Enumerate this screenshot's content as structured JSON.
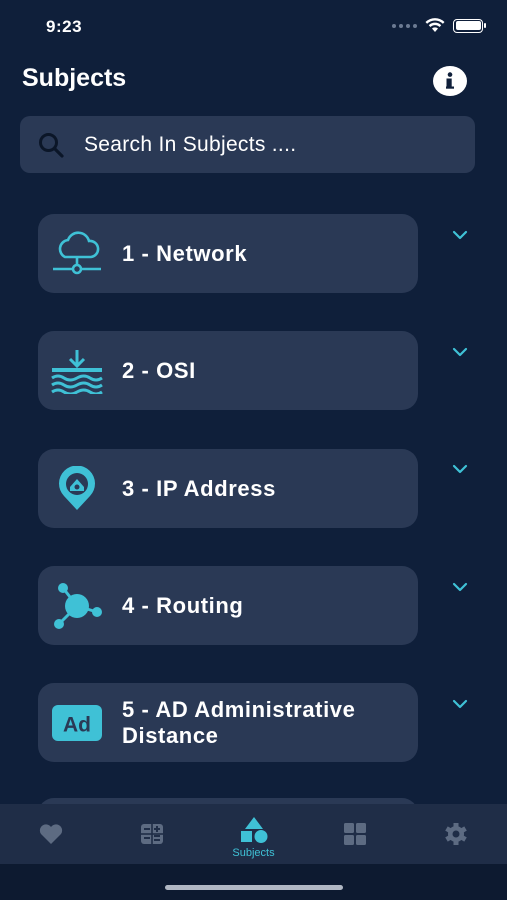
{
  "status_bar": {
    "time": "9:23"
  },
  "header": {
    "title": "Subjects"
  },
  "search": {
    "placeholder": "Search In Subjects ...."
  },
  "subjects": [
    {
      "label": "1 - Network",
      "icon": "cloud-network-icon"
    },
    {
      "label": "2 - OSI",
      "icon": "download-layers-icon"
    },
    {
      "label": "3 - IP Address",
      "icon": "location-pin-icon"
    },
    {
      "label": "4 - Routing",
      "icon": "hub-nodes-icon"
    },
    {
      "label": "5 - AD Administrative Distance",
      "icon": "ad-badge-icon",
      "badge": "Ad"
    }
  ],
  "tab_bar": {
    "tabs": [
      {
        "icon": "heart-icon",
        "label": ""
      },
      {
        "icon": "calculator-icon",
        "label": ""
      },
      {
        "icon": "shapes-icon",
        "label": "Subjects",
        "active": true
      },
      {
        "icon": "grid-icon",
        "label": ""
      },
      {
        "icon": "gear-icon",
        "label": ""
      }
    ]
  },
  "colors": {
    "background": "#0f1f3a",
    "card": "#2a3955",
    "accent": "#3fc1d6",
    "tab_inactive": "#5d6b82"
  }
}
